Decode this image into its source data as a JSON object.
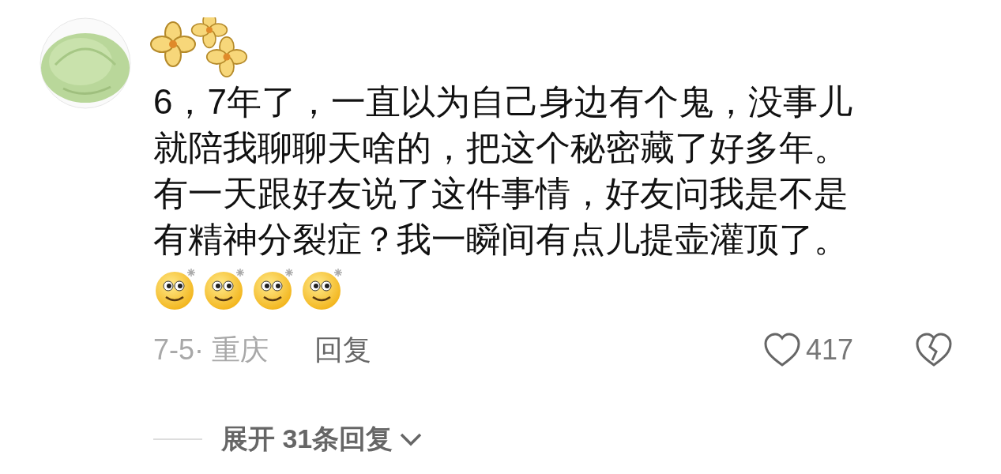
{
  "comment": {
    "text": "6，7年了，一直以为自己身边有个鬼，没事儿就陪我聊聊天啥的，把这个秘密藏了好多年。有一天跟好友说了这件事情，好友问我是不是有精神分裂症？我一瞬间有点儿提壶灌顶了。",
    "emojis": [
      {
        "kind": "sparkle-smile"
      },
      {
        "kind": "sparkle-smile"
      },
      {
        "kind": "sparkle-smile"
      },
      {
        "kind": "sparkle-smile"
      }
    ],
    "meta": "7-5· 重庆",
    "reply": "回复",
    "likes": "417",
    "liked": false,
    "disliked": false
  },
  "expand": {
    "label": "展开 31条回复"
  }
}
